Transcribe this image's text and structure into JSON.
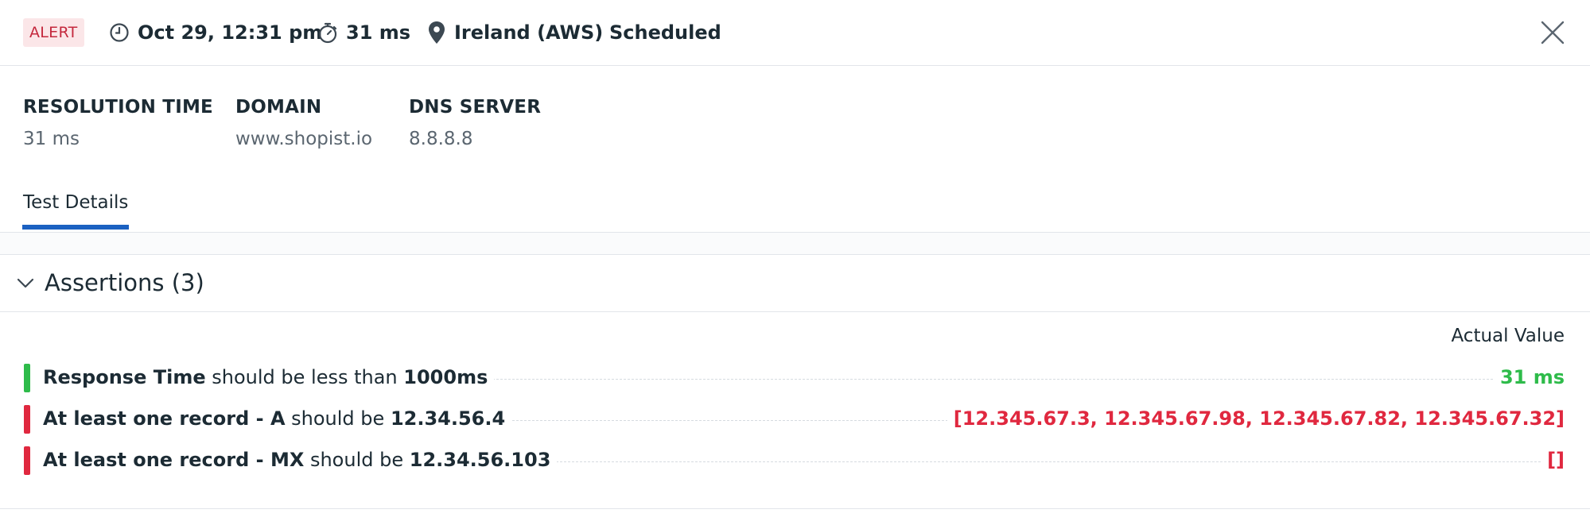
{
  "header": {
    "status_badge": "ALERT",
    "timestamp": "Oct 29, 12:31 pm",
    "duration": "31 ms",
    "location": "Ireland (AWS)",
    "run_type": "Scheduled",
    "icons": [
      "clock-icon",
      "stopwatch-icon",
      "location-pin-icon",
      "close-icon"
    ]
  },
  "summary": {
    "fields": [
      {
        "label": "RESOLUTION TIME",
        "value": "31 ms"
      },
      {
        "label": "DOMAIN",
        "value": "www.shopist.io"
      },
      {
        "label": "DNS SERVER",
        "value": "8.8.8.8"
      }
    ]
  },
  "tabs": [
    {
      "label": "Test Details",
      "active": true
    }
  ],
  "assertions": {
    "title": "Assertions (3)",
    "actual_value_header": "Actual Value",
    "rows": [
      {
        "subject": "Response Time",
        "operator": "should be less than",
        "target": "1000ms",
        "actual": "31 ms",
        "status": "pass"
      },
      {
        "subject": "At least one record - A",
        "operator": "should be",
        "target": "12.34.56.4",
        "actual": "[12.345.67.3, 12.345.67.98, 12.345.67.82, 12.345.67.32]",
        "status": "fail"
      },
      {
        "subject": "At least one record - MX",
        "operator": "should be",
        "target": "12.34.56.103",
        "actual": "[]",
        "status": "fail"
      }
    ]
  },
  "colors": {
    "alert_bg": "#fbe6e8",
    "alert_text": "#c4283d",
    "pass": "#2ebb4a",
    "fail": "#e0283f",
    "tab_accent": "#1b61c1"
  }
}
